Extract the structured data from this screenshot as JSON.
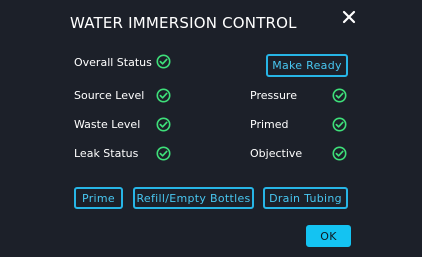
{
  "dialog": {
    "title": "WATER IMMERSION CONTROL",
    "close_icon": "close-icon"
  },
  "status": {
    "overall_label": "Overall Status",
    "source_label": "Source Level",
    "waste_label": "Waste Level",
    "leak_label": "Leak Status",
    "pressure_label": "Pressure",
    "primed_label": "Primed",
    "objective_label": "Objective",
    "check_icon": "check-circle-icon"
  },
  "buttons": {
    "make_ready": "Make Ready",
    "prime": "Prime",
    "refill": "Refill/Empty Bottles",
    "drain": "Drain Tubing",
    "ok": "OK"
  },
  "colors": {
    "background": "#1c2029",
    "accent": "#27b5e6",
    "status_ok": "#3ee07a",
    "primary_fill": "#14c3f2"
  }
}
